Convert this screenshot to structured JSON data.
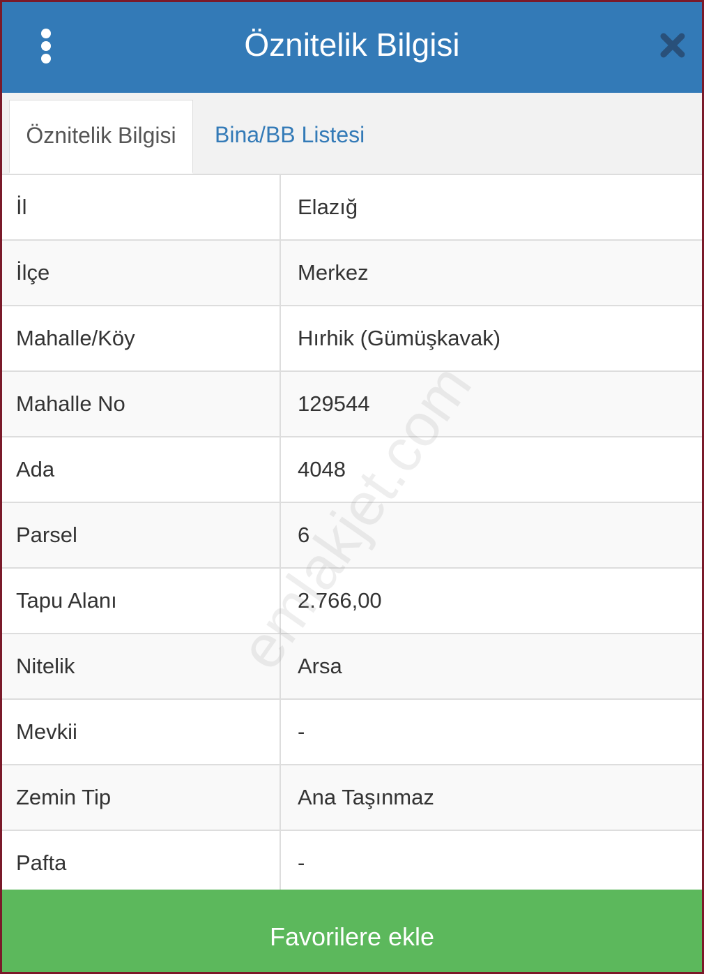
{
  "header": {
    "title": "Öznitelik Bilgisi",
    "menu_icon": "kebab-menu-icon",
    "close_icon": "close-icon",
    "color": "#337ab7"
  },
  "tabs": [
    {
      "label": "Öznitelik Bilgisi",
      "active": true
    },
    {
      "label": "Bina/BB Listesi",
      "active": false
    }
  ],
  "rows": [
    {
      "label": "İl",
      "value": "Elazığ"
    },
    {
      "label": "İlçe",
      "value": "Merkez"
    },
    {
      "label": "Mahalle/Köy",
      "value": "Hırhik (Gümüşkavak)"
    },
    {
      "label": "Mahalle No",
      "value": "129544"
    },
    {
      "label": "Ada",
      "value": "4048"
    },
    {
      "label": "Parsel",
      "value": "6"
    },
    {
      "label": "Tapu Alanı",
      "value": "2.766,00"
    },
    {
      "label": "Nitelik",
      "value": "Arsa"
    },
    {
      "label": "Mevkii",
      "value": "-"
    },
    {
      "label": "Zemin Tip",
      "value": "Ana Taşınmaz"
    },
    {
      "label": "Pafta",
      "value": "-"
    }
  ],
  "watermark": "emlakjet.com",
  "footer": {
    "button_label": "Favorilere ekle",
    "color": "#5cb85c"
  }
}
